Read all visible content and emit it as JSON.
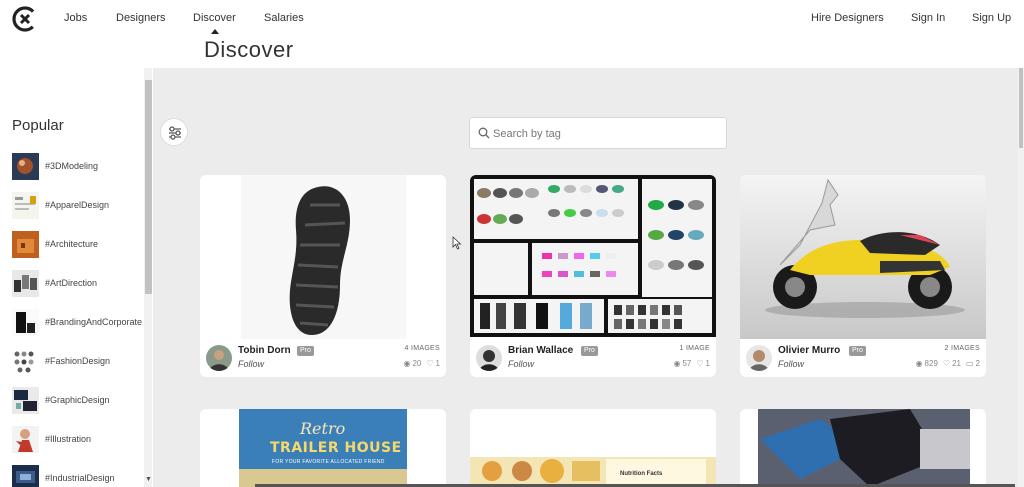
{
  "nav": {
    "links": [
      "Jobs",
      "Designers",
      "Discover",
      "Salaries"
    ],
    "right_links": [
      "Hire Designers",
      "Sign In",
      "Sign Up"
    ],
    "active": "Discover"
  },
  "page": {
    "title": "Discover"
  },
  "sidebar": {
    "title": "Popular",
    "tags": [
      {
        "label": "#3DModeling"
      },
      {
        "label": "#ApparelDesign"
      },
      {
        "label": "#Architecture"
      },
      {
        "label": "#ArtDirection"
      },
      {
        "label": "#BrandingAndCorporate"
      },
      {
        "label": "#FashionDesign"
      },
      {
        "label": "#GraphicDesign"
      },
      {
        "label": "#Illustration"
      },
      {
        "label": "#IndustrialDesign"
      }
    ]
  },
  "search": {
    "placeholder": "Search by tag"
  },
  "cards": [
    {
      "author": "Tobin Dorn",
      "badge": "Pro",
      "follow": "Follow",
      "images": "4 IMAGES",
      "views": "20",
      "likes": "1",
      "comments": ""
    },
    {
      "author": "Brian Wallace",
      "badge": "Pro",
      "follow": "Follow",
      "images": "1 IMAGE",
      "views": "57",
      "likes": "1",
      "comments": ""
    },
    {
      "author": "Olivier Murro",
      "badge": "Pro",
      "follow": "Follow",
      "images": "2 IMAGES",
      "views": "829",
      "likes": "21",
      "comments": "2"
    }
  ],
  "partial_cards": [
    {
      "title_line1": "Retro",
      "title_line2": "TRAILER HOUSE",
      "title_line3": "FOR YOUR FAVORITE ALLOCATED FRIEND"
    },
    {
      "text": "Nutrition Facts"
    },
    {}
  ],
  "colors": {
    "accent": "#333333",
    "background": "#ececec",
    "badge": "#999999"
  }
}
